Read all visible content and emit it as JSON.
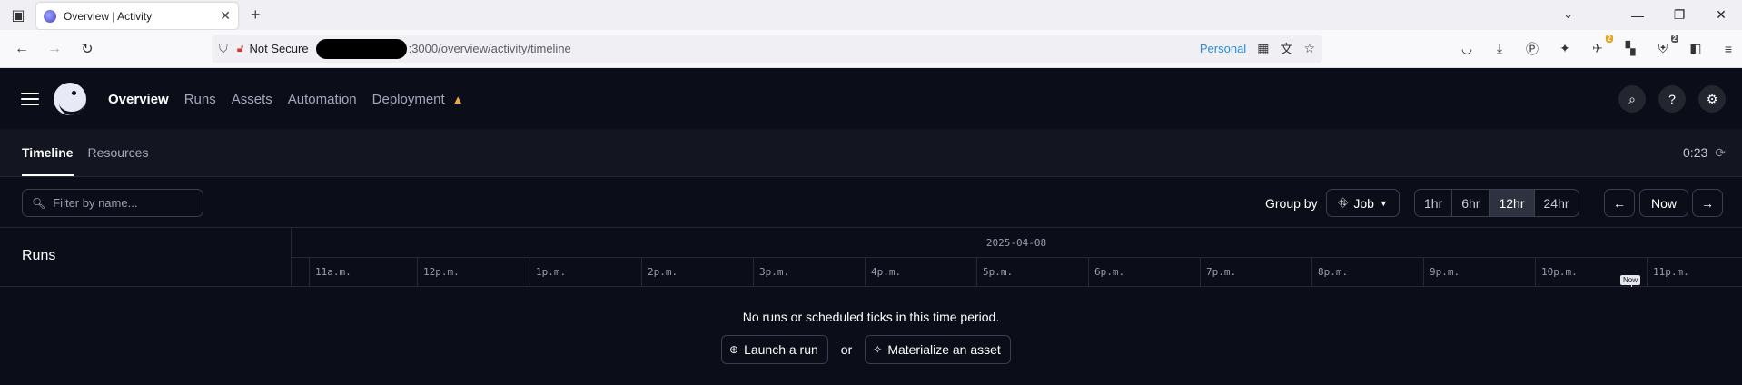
{
  "browser": {
    "tab_title": "Overview | Activity",
    "tab_close": "✕",
    "new_tab": "+",
    "url_not_secure": "Not Secure",
    "url_text": ":3000/overview/activity/timeline",
    "url_personal": "Personal",
    "window_controls": [
      "—",
      "❐",
      "✕"
    ],
    "ext_badge_1": "2",
    "ext_badge_2": "2"
  },
  "app": {
    "nav": {
      "items": [
        {
          "label": "Overview",
          "active": true
        },
        {
          "label": "Runs"
        },
        {
          "label": "Assets"
        },
        {
          "label": "Automation"
        },
        {
          "label": "Deployment"
        }
      ],
      "warning_icon": "warning-triangle-icon"
    },
    "subtabs": [
      {
        "label": "Timeline",
        "active": true
      },
      {
        "label": "Resources"
      }
    ],
    "refresh_time": "0:23",
    "filter": {
      "placeholder": "Filter by name..."
    },
    "group_by": {
      "label": "Group by",
      "value": "Job"
    },
    "ranges": [
      "1hr",
      "6hr",
      "12hr",
      "24hr"
    ],
    "active_range": "12hr",
    "now_button": "Now",
    "timeline": {
      "runs_label": "Runs",
      "date": "2025-04-08",
      "hours": [
        "11a.m.",
        "12p.m.",
        "1p.m.",
        "2p.m.",
        "3p.m.",
        "4p.m.",
        "5p.m.",
        "6p.m.",
        "7p.m.",
        "8p.m.",
        "9p.m.",
        "10p.m.",
        "11p.m."
      ],
      "now_tag": "Now"
    },
    "empty": {
      "message": "No runs or scheduled ticks in this time period.",
      "launch_run": "Launch a run",
      "or": "or",
      "materialize": "Materialize an asset"
    }
  }
}
